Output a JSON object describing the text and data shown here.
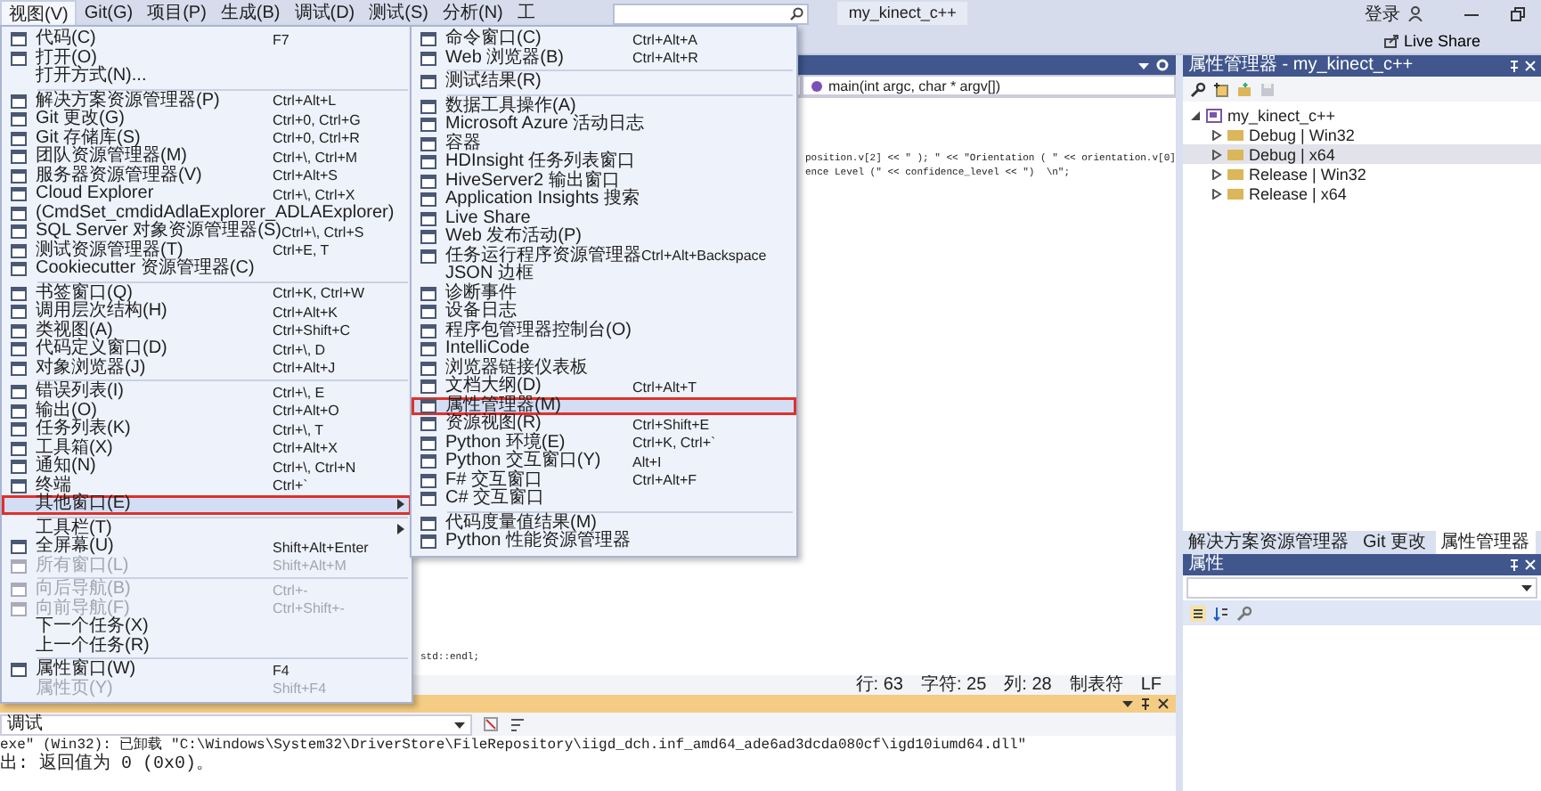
{
  "menu_bar": {
    "items": [
      {
        "label": "视图(V)",
        "selected": true
      },
      {
        "label": "Git(G)",
        "selected": false
      },
      {
        "label": "项目(P)",
        "selected": false
      },
      {
        "label": "生成(B)",
        "selected": false
      },
      {
        "label": "调试(D)",
        "selected": false
      },
      {
        "label": "测试(S)",
        "selected": false
      },
      {
        "label": "分析(N)",
        "selected": false
      },
      {
        "label": "工",
        "selected": false
      }
    ]
  },
  "solution_name": "my_kinect_c++",
  "account": {
    "label": "登录"
  },
  "toolbar": {
    "live_share": "Live Share"
  },
  "view_menu": {
    "items": [
      {
        "kind": "item",
        "label": "代码(C)",
        "shortcut": "F7",
        "icon": true,
        "disabled": false,
        "selected": false,
        "submenu": false,
        "outlined": false
      },
      {
        "kind": "item",
        "label": "打开(O)",
        "icon": true,
        "disabled": false,
        "selected": false,
        "submenu": false,
        "outlined": false
      },
      {
        "kind": "item",
        "label": "打开方式(N)...",
        "icon": false,
        "disabled": false,
        "selected": false,
        "submenu": false,
        "outlined": false
      },
      {
        "kind": "separator"
      },
      {
        "kind": "item",
        "label": "解决方案资源管理器(P)",
        "shortcut": "Ctrl+Alt+L",
        "icon": true,
        "disabled": false,
        "selected": false,
        "submenu": false,
        "outlined": false
      },
      {
        "kind": "item",
        "label": "Git 更改(G)",
        "shortcut": "Ctrl+0, Ctrl+G",
        "icon": true,
        "disabled": false,
        "selected": false,
        "submenu": false,
        "outlined": false
      },
      {
        "kind": "item",
        "label": "Git 存储库(S)",
        "shortcut": "Ctrl+0, Ctrl+R",
        "icon": true,
        "disabled": false,
        "selected": false,
        "submenu": false,
        "outlined": false
      },
      {
        "kind": "item",
        "label": "团队资源管理器(M)",
        "shortcut": "Ctrl+\\, Ctrl+M",
        "icon": true,
        "disabled": false,
        "selected": false,
        "submenu": false,
        "outlined": false
      },
      {
        "kind": "item",
        "label": "服务器资源管理器(V)",
        "shortcut": "Ctrl+Alt+S",
        "icon": true,
        "disabled": false,
        "selected": false,
        "submenu": false,
        "outlined": false
      },
      {
        "kind": "item",
        "label": "Cloud Explorer",
        "shortcut": "Ctrl+\\, Ctrl+X",
        "icon": true,
        "disabled": false,
        "selected": false,
        "submenu": false,
        "outlined": false
      },
      {
        "kind": "item",
        "label": "(CmdSet_cmdidAdlaExplorer_ADLAExplorer)",
        "icon": true,
        "disabled": false,
        "selected": false,
        "submenu": false,
        "outlined": false
      },
      {
        "kind": "item",
        "label": "SQL Server 对象资源管理器(S)",
        "shortcut": "Ctrl+\\, Ctrl+S",
        "icon": true,
        "disabled": false,
        "selected": false,
        "submenu": false,
        "outlined": false
      },
      {
        "kind": "item",
        "label": "测试资源管理器(T)",
        "shortcut": "Ctrl+E, T",
        "icon": true,
        "disabled": false,
        "selected": false,
        "submenu": false,
        "outlined": false
      },
      {
        "kind": "item",
        "label": "Cookiecutter 资源管理器(C)",
        "icon": true,
        "disabled": false,
        "selected": false,
        "submenu": false,
        "outlined": false
      },
      {
        "kind": "separator"
      },
      {
        "kind": "item",
        "label": "书签窗口(Q)",
        "shortcut": "Ctrl+K, Ctrl+W",
        "icon": true,
        "disabled": false,
        "selected": false,
        "submenu": false,
        "outlined": false
      },
      {
        "kind": "item",
        "label": "调用层次结构(H)",
        "shortcut": "Ctrl+Alt+K",
        "icon": true,
        "disabled": false,
        "selected": false,
        "submenu": false,
        "outlined": false
      },
      {
        "kind": "item",
        "label": "类视图(A)",
        "shortcut": "Ctrl+Shift+C",
        "icon": true,
        "disabled": false,
        "selected": false,
        "submenu": false,
        "outlined": false
      },
      {
        "kind": "item",
        "label": "代码定义窗口(D)",
        "shortcut": "Ctrl+\\, D",
        "icon": true,
        "disabled": false,
        "selected": false,
        "submenu": false,
        "outlined": false
      },
      {
        "kind": "item",
        "label": "对象浏览器(J)",
        "shortcut": "Ctrl+Alt+J",
        "icon": true,
        "disabled": false,
        "selected": false,
        "submenu": false,
        "outlined": false
      },
      {
        "kind": "separator"
      },
      {
        "kind": "item",
        "label": "错误列表(I)",
        "shortcut": "Ctrl+\\, E",
        "icon": true,
        "disabled": false,
        "selected": false,
        "submenu": false,
        "outlined": false
      },
      {
        "kind": "item",
        "label": "输出(O)",
        "shortcut": "Ctrl+Alt+O",
        "icon": true,
        "disabled": false,
        "selected": false,
        "submenu": false,
        "outlined": false
      },
      {
        "kind": "item",
        "label": "任务列表(K)",
        "shortcut": "Ctrl+\\, T",
        "icon": true,
        "disabled": false,
        "selected": false,
        "submenu": false,
        "outlined": false
      },
      {
        "kind": "item",
        "label": "工具箱(X)",
        "shortcut": "Ctrl+Alt+X",
        "icon": true,
        "disabled": false,
        "selected": false,
        "submenu": false,
        "outlined": false
      },
      {
        "kind": "item",
        "label": "通知(N)",
        "shortcut": "Ctrl+\\, Ctrl+N",
        "icon": true,
        "disabled": false,
        "selected": false,
        "submenu": false,
        "outlined": false
      },
      {
        "kind": "item",
        "label": "终端",
        "shortcut": "Ctrl+`",
        "icon": true,
        "disabled": false,
        "selected": false,
        "submenu": false,
        "outlined": false
      },
      {
        "kind": "item",
        "label": "其他窗口(E)",
        "icon": false,
        "disabled": false,
        "selected": true,
        "submenu": true,
        "outlined": true
      },
      {
        "kind": "separator"
      },
      {
        "kind": "item",
        "label": "工具栏(T)",
        "icon": false,
        "disabled": false,
        "selected": false,
        "submenu": true,
        "outlined": false
      },
      {
        "kind": "item",
        "label": "全屏幕(U)",
        "shortcut": "Shift+Alt+Enter",
        "icon": true,
        "disabled": false,
        "selected": false,
        "submenu": false,
        "outlined": false
      },
      {
        "kind": "item",
        "label": "所有窗口(L)",
        "shortcut": "Shift+Alt+M",
        "icon": true,
        "disabled": true,
        "selected": false,
        "submenu": false,
        "outlined": false
      },
      {
        "kind": "separator"
      },
      {
        "kind": "item",
        "label": "向后导航(B)",
        "shortcut": "Ctrl+-",
        "icon": true,
        "disabled": true,
        "selected": false,
        "submenu": false,
        "outlined": false
      },
      {
        "kind": "item",
        "label": "向前导航(F)",
        "shortcut": "Ctrl+Shift+-",
        "icon": true,
        "disabled": true,
        "selected": false,
        "submenu": false,
        "outlined": false
      },
      {
        "kind": "item",
        "label": "下一个任务(X)",
        "icon": false,
        "disabled": false,
        "selected": false,
        "submenu": false,
        "outlined": false
      },
      {
        "kind": "item",
        "label": "上一个任务(R)",
        "icon": false,
        "disabled": false,
        "selected": false,
        "submenu": false,
        "outlined": false
      },
      {
        "kind": "separator"
      },
      {
        "kind": "item",
        "label": "属性窗口(W)",
        "shortcut": "F4",
        "icon": true,
        "disabled": false,
        "selected": false,
        "submenu": false,
        "outlined": false
      },
      {
        "kind": "item",
        "label": "属性页(Y)",
        "shortcut": "Shift+F4",
        "icon": false,
        "disabled": true,
        "selected": false,
        "submenu": false,
        "outlined": false
      }
    ]
  },
  "other_windows_menu": {
    "items": [
      {
        "kind": "item",
        "label": "命令窗口(C)",
        "shortcut": "Ctrl+Alt+A",
        "icon": true,
        "disabled": false,
        "selected": false,
        "submenu": false,
        "outlined": false
      },
      {
        "kind": "item",
        "label": "Web 浏览器(B)",
        "shortcut": "Ctrl+Alt+R",
        "icon": true,
        "disabled": false,
        "selected": false,
        "submenu": false,
        "outlined": false
      },
      {
        "kind": "separator"
      },
      {
        "kind": "item",
        "label": "测试结果(R)",
        "icon": true,
        "disabled": false,
        "selected": false,
        "submenu": false,
        "outlined": false
      },
      {
        "kind": "separator"
      },
      {
        "kind": "item",
        "label": "数据工具操作(A)",
        "icon": true,
        "disabled": false,
        "selected": false,
        "submenu": false,
        "outlined": false
      },
      {
        "kind": "item",
        "label": "Microsoft Azure 活动日志",
        "icon": true,
        "disabled": false,
        "selected": false,
        "submenu": false,
        "outlined": false
      },
      {
        "kind": "item",
        "label": "容器",
        "icon": true,
        "disabled": false,
        "selected": false,
        "submenu": false,
        "outlined": false
      },
      {
        "kind": "item",
        "label": "HDInsight 任务列表窗口",
        "icon": true,
        "disabled": false,
        "selected": false,
        "submenu": false,
        "outlined": false
      },
      {
        "kind": "item",
        "label": "HiveServer2 输出窗口",
        "icon": true,
        "disabled": false,
        "selected": false,
        "submenu": false,
        "outlined": false
      },
      {
        "kind": "item",
        "label": "Application Insights 搜索",
        "icon": true,
        "disabled": false,
        "selected": false,
        "submenu": false,
        "outlined": false
      },
      {
        "kind": "item",
        "label": "Live Share",
        "icon": true,
        "disabled": false,
        "selected": false,
        "submenu": false,
        "outlined": false
      },
      {
        "kind": "item",
        "label": "Web 发布活动(P)",
        "icon": true,
        "disabled": false,
        "selected": false,
        "submenu": false,
        "outlined": false
      },
      {
        "kind": "item",
        "label": "任务运行程序资源管理器",
        "shortcut": "Ctrl+Alt+Backspace",
        "icon": true,
        "disabled": false,
        "selected": false,
        "submenu": false,
        "outlined": false
      },
      {
        "kind": "item",
        "label": "JSON 边框",
        "icon": false,
        "disabled": false,
        "selected": false,
        "submenu": false,
        "outlined": false
      },
      {
        "kind": "item",
        "label": "诊断事件",
        "icon": true,
        "disabled": false,
        "selected": false,
        "submenu": false,
        "outlined": false
      },
      {
        "kind": "item",
        "label": "设备日志",
        "icon": true,
        "disabled": false,
        "selected": false,
        "submenu": false,
        "outlined": false
      },
      {
        "kind": "item",
        "label": "程序包管理器控制台(O)",
        "icon": true,
        "disabled": false,
        "selected": false,
        "submenu": false,
        "outlined": false
      },
      {
        "kind": "item",
        "label": "IntelliCode",
        "icon": true,
        "disabled": false,
        "selected": false,
        "submenu": false,
        "outlined": false
      },
      {
        "kind": "item",
        "label": "浏览器链接仪表板",
        "icon": true,
        "disabled": false,
        "selected": false,
        "submenu": false,
        "outlined": false
      },
      {
        "kind": "item",
        "label": "文档大纲(D)",
        "shortcut": "Ctrl+Alt+T",
        "icon": true,
        "disabled": false,
        "selected": false,
        "submenu": false,
        "outlined": false
      },
      {
        "kind": "item",
        "label": "属性管理器(M)",
        "icon": true,
        "disabled": false,
        "selected": true,
        "submenu": false,
        "outlined": true
      },
      {
        "kind": "item",
        "label": "资源视图(R)",
        "shortcut": "Ctrl+Shift+E",
        "icon": true,
        "disabled": false,
        "selected": false,
        "submenu": false,
        "outlined": false
      },
      {
        "kind": "item",
        "label": "Python 环境(E)",
        "shortcut": "Ctrl+K, Ctrl+`",
        "icon": true,
        "disabled": false,
        "selected": false,
        "submenu": false,
        "outlined": false
      },
      {
        "kind": "item",
        "label": "Python 交互窗口(Y)",
        "shortcut": "Alt+I",
        "icon": true,
        "disabled": false,
        "selected": false,
        "submenu": false,
        "outlined": false
      },
      {
        "kind": "item",
        "label": "F# 交互窗口",
        "shortcut": "Ctrl+Alt+F",
        "icon": true,
        "disabled": false,
        "selected": false,
        "submenu": false,
        "outlined": false
      },
      {
        "kind": "item",
        "label": "C# 交互窗口",
        "icon": true,
        "disabled": false,
        "selected": false,
        "submenu": false,
        "outlined": false
      },
      {
        "kind": "separator"
      },
      {
        "kind": "item",
        "label": "代码度量值结果(M)",
        "icon": true,
        "disabled": false,
        "selected": false,
        "submenu": false,
        "outlined": false
      },
      {
        "kind": "item",
        "label": "Python 性能资源管理器",
        "icon": true,
        "disabled": false,
        "selected": false,
        "submenu": false,
        "outlined": false
      }
    ]
  },
  "editor": {
    "function_dropdown": "main(int argc, char * argv[])",
    "code_lines": [
      "position.v[2] << \" ); \" << \"Orientation ( \" << orientation.v[0]",
      "ence Level (\" << confidence_level << \")  \\n\";"
    ],
    "code_tail": "std::endl;",
    "status": [
      "行: 63",
      "字符: 25",
      "列: 28",
      "制表符",
      "LF"
    ]
  },
  "output": {
    "source": "调试",
    "lines": [
      "exe\" (Win32): 已卸载 \"C:\\Windows\\System32\\DriverStore\\FileRepository\\iigd_dch.inf_amd64_ade6ad3dcda080cf\\igd10iumd64.dll\"",
      "出: 返回值为 0 (0x0)。"
    ]
  },
  "property_manager": {
    "title": "属性管理器 - my_kinect_c++",
    "tree": [
      {
        "label": "my_kinect_c++",
        "expanded": true,
        "selected": false,
        "children": [
          {
            "label": "Debug | Win32",
            "expanded": false,
            "selected": false
          },
          {
            "label": "Debug | x64",
            "expanded": false,
            "selected": true
          },
          {
            "label": "Release | Win32",
            "expanded": false,
            "selected": false
          },
          {
            "label": "Release | x64",
            "expanded": false,
            "selected": false
          }
        ]
      }
    ]
  },
  "panel_tabs": [
    {
      "label": "解决方案资源管理器",
      "selected": false
    },
    {
      "label": "Git 更改",
      "selected": false
    },
    {
      "label": "属性管理器",
      "selected": true
    }
  ],
  "properties": {
    "title": "属性"
  }
}
